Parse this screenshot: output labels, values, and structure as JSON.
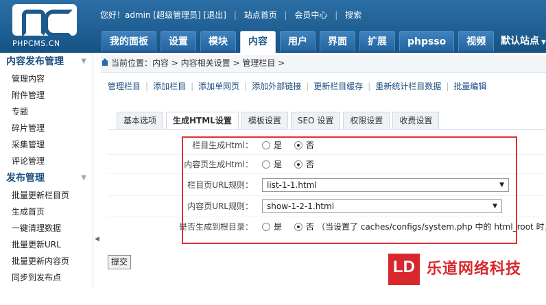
{
  "logo": {
    "text": "PHPCMS.CN"
  },
  "topnav": {
    "greeting": "您好！admin [超级管理员]",
    "logout": "[退出]",
    "site_home": "站点首页",
    "member_center": "会员中心",
    "search": "搜索"
  },
  "main_tabs": [
    "我的面板",
    "设置",
    "模块",
    "内容",
    "用户",
    "界面",
    "扩展",
    "phpsso",
    "视频"
  ],
  "site_dropdown": "默认站点",
  "sidebar": {
    "sections": [
      {
        "title": "内容发布管理",
        "items": [
          "管理内容",
          "附件管理",
          "专题",
          "碎片管理",
          "采集管理",
          "评论管理"
        ]
      },
      {
        "title": "发布管理",
        "items": [
          "批量更新栏目页",
          "生成首页",
          "一键清理数据",
          "批量更新URL",
          "批量更新内容页",
          "同步到发布点"
        ]
      }
    ]
  },
  "breadcrumb": "当前位置：内容 > 内容相关设置 > 管理栏目 >",
  "subnav": [
    "管理栏目",
    "添加栏目",
    "添加单网页",
    "添加外部链接",
    "更新栏目缓存",
    "重新统计栏目数据",
    "批量编辑"
  ],
  "tabs": [
    "基本选项",
    "生成HTML设置",
    "模板设置",
    "SEO 设置",
    "权限设置",
    "收费设置"
  ],
  "active_tab": "生成HTML设置",
  "form": {
    "row1": {
      "label": "栏目生成Html：",
      "yes": "是",
      "no": "否",
      "selected": "否"
    },
    "row2": {
      "label": "内容页生成Html：",
      "yes": "是",
      "no": "否",
      "selected": "否"
    },
    "row3": {
      "label": "栏目页URL规则：",
      "value": "list-1-1.html"
    },
    "row4": {
      "label": "内容页URL规则：",
      "value": "show-1-2-1.html"
    },
    "row5": {
      "label": "是否生成到根目录：",
      "yes": "是",
      "no": "否",
      "selected": "否",
      "note": "（当设置了 caches/configs/system.php 中的 html_root 时，将"
    }
  },
  "submit_label": "提交",
  "watermark": {
    "box": "LD",
    "sub": "乐道网络科技",
    "text": "乐道网络科技"
  },
  "colors": {
    "header": "#1d5a8c",
    "highlight_box": "#e03030",
    "watermark": "#d9272e"
  }
}
